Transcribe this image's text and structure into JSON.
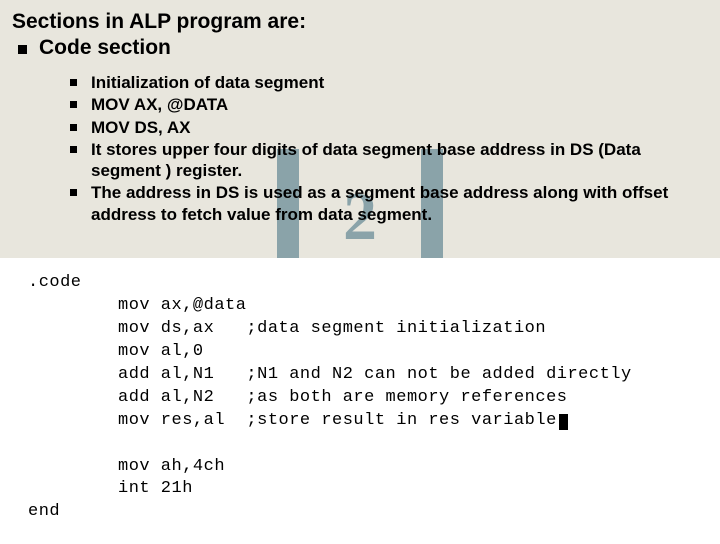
{
  "heading": "Sections in ALP program are:",
  "main_bullet": "Code section",
  "sub_bullets": [
    "Initialization of data segment",
    "MOV AX, @DATA",
    "MOV DS, AX",
    "It stores upper four digits of data segment base address in DS (Data segment ) register.",
    "The address in DS is used as a segment base address along with offset address to fetch value from data segment."
  ],
  "code": {
    "l0": ".code",
    "l1": "mov ax,@data",
    "l2": "mov ds,ax   ;data segment initialization",
    "l3": "mov al,0",
    "l4": "add al,N1   ;N1 and N2 can not be added directly",
    "l5": "add al,N2   ;as both are memory references",
    "l6": "mov res,al  ;store result in res variable",
    "l7": "mov ah,4ch",
    "l8": "int 21h",
    "l9": "end"
  },
  "watermark_text": "2"
}
